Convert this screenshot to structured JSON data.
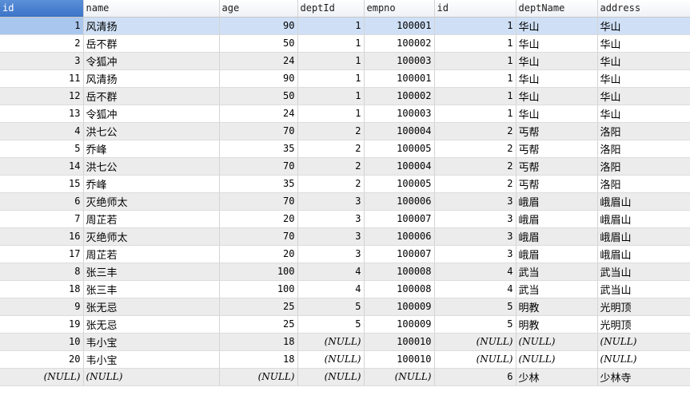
{
  "columns": [
    "id",
    "name",
    "age",
    "deptId",
    "empno",
    "id",
    "deptName",
    "address"
  ],
  "null_text": "(NULL)",
  "selected_row": 0,
  "rows": [
    [
      "1",
      "风清扬",
      "90",
      "1",
      "100001",
      "1",
      "华山",
      "华山"
    ],
    [
      "2",
      "岳不群",
      "50",
      "1",
      "100002",
      "1",
      "华山",
      "华山"
    ],
    [
      "3",
      "令狐冲",
      "24",
      "1",
      "100003",
      "1",
      "华山",
      "华山"
    ],
    [
      "11",
      "风清扬",
      "90",
      "1",
      "100001",
      "1",
      "华山",
      "华山"
    ],
    [
      "12",
      "岳不群",
      "50",
      "1",
      "100002",
      "1",
      "华山",
      "华山"
    ],
    [
      "13",
      "令狐冲",
      "24",
      "1",
      "100003",
      "1",
      "华山",
      "华山"
    ],
    [
      "4",
      "洪七公",
      "70",
      "2",
      "100004",
      "2",
      "丐帮",
      "洛阳"
    ],
    [
      "5",
      "乔峰",
      "35",
      "2",
      "100005",
      "2",
      "丐帮",
      "洛阳"
    ],
    [
      "14",
      "洪七公",
      "70",
      "2",
      "100004",
      "2",
      "丐帮",
      "洛阳"
    ],
    [
      "15",
      "乔峰",
      "35",
      "2",
      "100005",
      "2",
      "丐帮",
      "洛阳"
    ],
    [
      "6",
      "灭绝师太",
      "70",
      "3",
      "100006",
      "3",
      "峨眉",
      "峨眉山"
    ],
    [
      "7",
      "周芷若",
      "20",
      "3",
      "100007",
      "3",
      "峨眉",
      "峨眉山"
    ],
    [
      "16",
      "灭绝师太",
      "70",
      "3",
      "100006",
      "3",
      "峨眉",
      "峨眉山"
    ],
    [
      "17",
      "周芷若",
      "20",
      "3",
      "100007",
      "3",
      "峨眉",
      "峨眉山"
    ],
    [
      "8",
      "张三丰",
      "100",
      "4",
      "100008",
      "4",
      "武当",
      "武当山"
    ],
    [
      "18",
      "张三丰",
      "100",
      "4",
      "100008",
      "4",
      "武当",
      "武当山"
    ],
    [
      "9",
      "张无忌",
      "25",
      "5",
      "100009",
      "5",
      "明教",
      "光明顶"
    ],
    [
      "19",
      "张无忌",
      "25",
      "5",
      "100009",
      "5",
      "明教",
      "光明顶"
    ],
    [
      "10",
      "韦小宝",
      "18",
      "(NULL)",
      "100010",
      "(NULL)",
      "(NULL)",
      "(NULL)"
    ],
    [
      "20",
      "韦小宝",
      "18",
      "(NULL)",
      "100010",
      "(NULL)",
      "(NULL)",
      "(NULL)"
    ],
    [
      "(NULL)",
      "(NULL)",
      "(NULL)",
      "(NULL)",
      "(NULL)",
      "6",
      "少林",
      "少林寺"
    ]
  ]
}
